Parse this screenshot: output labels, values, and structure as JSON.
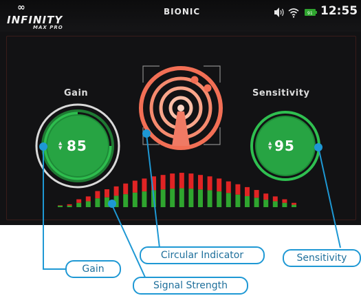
{
  "header": {
    "logo_symbol": "∞",
    "logo_title": "INFINITY",
    "logo_subtitle": "MAX PRO",
    "mode": "BIONIC",
    "battery": "91",
    "time": "12:55",
    "status_icons": [
      "volume-icon",
      "wifi-icon",
      "battery-icon"
    ]
  },
  "gain": {
    "label": "Gain",
    "value": "85"
  },
  "sensitivity": {
    "label": "Sensitivity",
    "value": "95"
  },
  "signal_bars": {
    "levels": [
      0.05,
      0.08,
      0.22,
      0.3,
      0.45,
      0.5,
      0.58,
      0.66,
      0.74,
      0.8,
      0.86,
      0.9,
      0.94,
      0.96,
      0.94,
      0.9,
      0.86,
      0.8,
      0.72,
      0.64,
      0.56,
      0.48,
      0.38,
      0.3,
      0.22,
      0.12
    ],
    "colors": {
      "top": "#e02424",
      "bottom": "#2fa52f"
    }
  },
  "callouts": {
    "gain": "Gain",
    "signal_strength": "Signal Strength",
    "circular_indicator": "Circular Indicator",
    "sensitivity": "Sensitivity"
  },
  "colors": {
    "accent_blue": "#1e98d4",
    "dial_green": "#26a641",
    "indicator_orange": "#ef6b4f"
  }
}
